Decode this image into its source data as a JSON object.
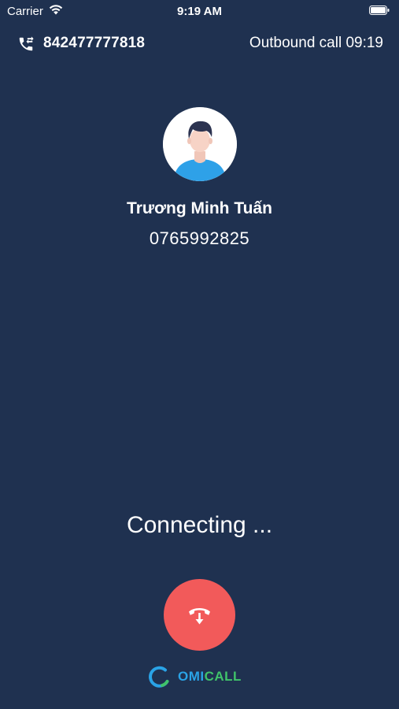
{
  "status_bar": {
    "carrier": "Carrier",
    "time": "9:19 AM",
    "icons": [
      "wifi-icon",
      "battery-icon"
    ]
  },
  "call_header": {
    "icon": "call-transfer-icon",
    "number": "842477777818",
    "direction": "Outbound call 09:19"
  },
  "contact": {
    "avatar_icon": "user-avatar",
    "name": "Trương Minh Tuấn",
    "phone": "0765992825"
  },
  "call_status": "Connecting ...",
  "hangup": {
    "icon": "hangup-phone-icon",
    "color": "#f25a5a"
  },
  "brand": {
    "omi": "OMI",
    "call": "CALL",
    "omi_color": "#2aa3e6",
    "call_color": "#40c36a"
  },
  "colors": {
    "background": "#1f3150",
    "text": "#ffffff"
  }
}
